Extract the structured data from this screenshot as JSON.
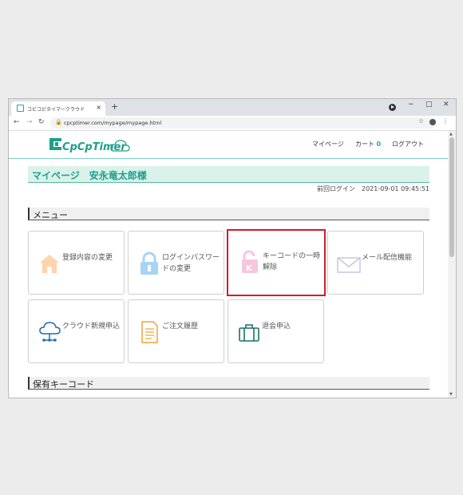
{
  "browser": {
    "tab_title": "コピコピタイマークラウド",
    "tab_close": "×",
    "new_tab": "+",
    "url": "cpcptimer.com/mypage/mypage.html",
    "window_controls": [
      "−",
      "□",
      "✕"
    ]
  },
  "site": {
    "logo_text": "CpCpTimer",
    "nav": {
      "mypage": "マイページ",
      "cart": "カート",
      "cart_count": "0",
      "logout": "ログアウト"
    }
  },
  "page": {
    "title": "マイページ　安永竜太郎様",
    "last_login": "前回ログイン　2021-09-01 09:45:51",
    "menu_heading": "メニュー",
    "keys_heading": "保有キーコード"
  },
  "menu": {
    "items": [
      {
        "label": "登録内容の変更",
        "icon": "home-icon",
        "color": "#ffd3ad"
      },
      {
        "label": "ログインパスワードの変更",
        "icon": "lock-icon",
        "color": "#a6d4f5"
      },
      {
        "label": "キーコードの一時解除",
        "icon": "key-unlock-icon",
        "color": "#f7c6dd",
        "selected": true
      },
      {
        "label": "メール配信機能",
        "icon": "mail-icon",
        "color": "#c9c6e6"
      },
      {
        "label": "クラウド新規申込",
        "icon": "cloud-icon",
        "color": "#1f6fb0"
      },
      {
        "label": "ご注文履歴",
        "icon": "document-icon",
        "color": "#f0a23a"
      },
      {
        "label": "退会申込",
        "icon": "suitcase-icon",
        "color": "#1b6f6a"
      }
    ]
  },
  "colors": {
    "accent": "#1d9f8a",
    "title_bg": "#daf2ea",
    "selected_border": "#d01c2c"
  }
}
